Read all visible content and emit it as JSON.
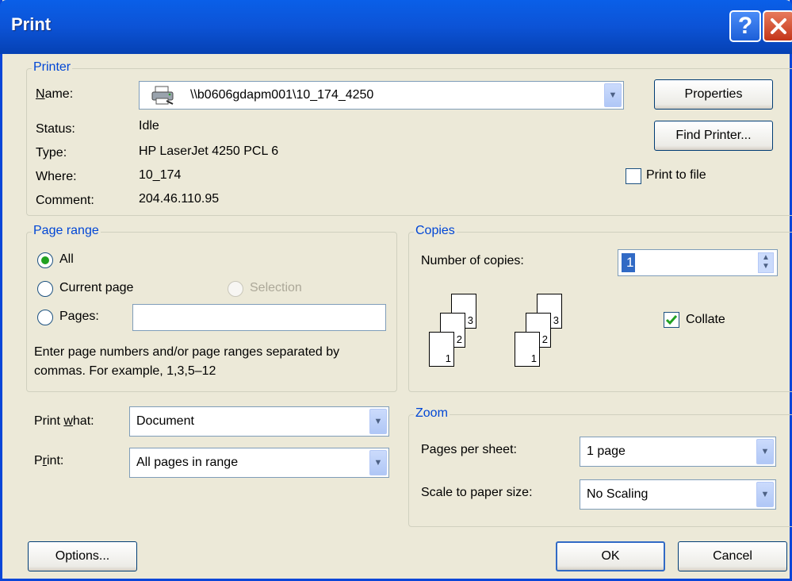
{
  "window": {
    "title": "Print",
    "help_glyph": "?",
    "close_glyph": "✕"
  },
  "printer": {
    "group_label": "Printer",
    "name_label": "Name:",
    "name_value": "\\\\b0606gdapm001\\10_174_4250",
    "status_label": "Status:",
    "status_value": "Idle",
    "type_label": "Type:",
    "type_value": "HP LaserJet 4250 PCL 6",
    "where_label": "Where:",
    "where_value": "10_174",
    "comment_label": "Comment:",
    "comment_value": "204.46.110.95",
    "properties_button": "Properties",
    "find_printer_button": "Find Printer...",
    "print_to_file_label": "Print to file",
    "print_to_file_checked": false
  },
  "page_range": {
    "group_label": "Page range",
    "all_label": "All",
    "current_page_label": "Current page",
    "selection_label": "Selection",
    "pages_label": "Pages:",
    "pages_value": "",
    "selected": "all",
    "hint": "Enter page numbers and/or page ranges separated by commas.  For example, 1,3,5–12"
  },
  "copies": {
    "group_label": "Copies",
    "number_label": "Number of copies:",
    "number_value": "1",
    "collate_label": "Collate",
    "collate_checked": true,
    "page_numbers": [
      "1",
      "2",
      "3"
    ]
  },
  "print_options": {
    "print_what_label": "Print what:",
    "print_what_value": "Document",
    "print_label": "Print:",
    "print_value": "All pages in range"
  },
  "zoom": {
    "group_label": "Zoom",
    "pages_per_sheet_label": "Pages per sheet:",
    "pages_per_sheet_value": "1 page",
    "scale_label": "Scale to paper size:",
    "scale_value": "No Scaling"
  },
  "footer": {
    "options_button": "Options...",
    "ok_button": "OK",
    "cancel_button": "Cancel"
  },
  "icons": {
    "printer": "printer-icon",
    "dropdown": "chevron-down-icon",
    "spinner": "spinner-arrows-icon"
  },
  "colors": {
    "titlebar": "#0a5fe8",
    "group_label": "#0046d5",
    "dialog_bg": "#ece9d8",
    "check_green": "#21a121"
  }
}
